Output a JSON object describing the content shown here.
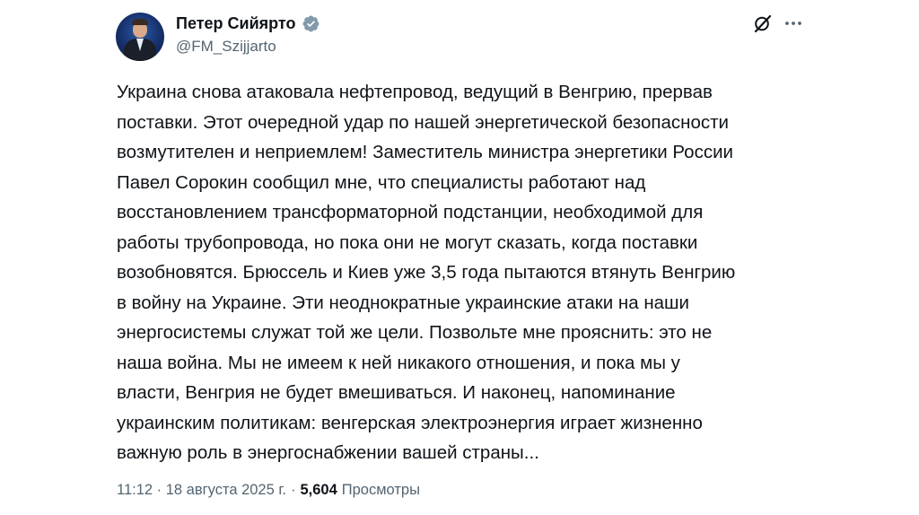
{
  "author": {
    "display_name": "Петер Сийярто",
    "handle": "@FM_Szijjarto",
    "verified_color": "#829aab"
  },
  "tweet": {
    "text": "Украина снова атаковала нефтепровод, ведущий в Венгрию, прервав\nпоставки. Этот очередной удар по нашей энергетической безопасности\nвозмутителен и неприемлем! Заместитель министра энергетики России\nПавел Сорокин сообщил мне, что специалисты работают над\nвосстановлением трансформаторной подстанции, необходимой для\nработы трубопровода, но пока они не могут сказать, когда поставки\nвозобновятся. Брюссель и Киев уже 3,5 года пытаются втянуть Венгрию\nв войну на Украине. Эти неоднократные украинские атаки на наши\nэнергосистемы служат той же цели. Позвольте мне прояснить: это не\nнаша война. Мы не имеем к ней никакого отношения, и пока мы у\nвласти, Венгрия не будет вмешиваться. И наконец, напоминание\nукраинским политикам: венгерская электроэнергия играет жизненно\nважную роль в энергоснабжении вашей страны..."
  },
  "meta": {
    "timestamp": "11:12 · 18 августа 2025 г.",
    "separator": "·",
    "views_count": "5,604",
    "views_label": "Просмотры"
  },
  "icons": {
    "verified": "verified-badge-icon",
    "grok": "grok-icon",
    "more": "more-options-icon"
  }
}
